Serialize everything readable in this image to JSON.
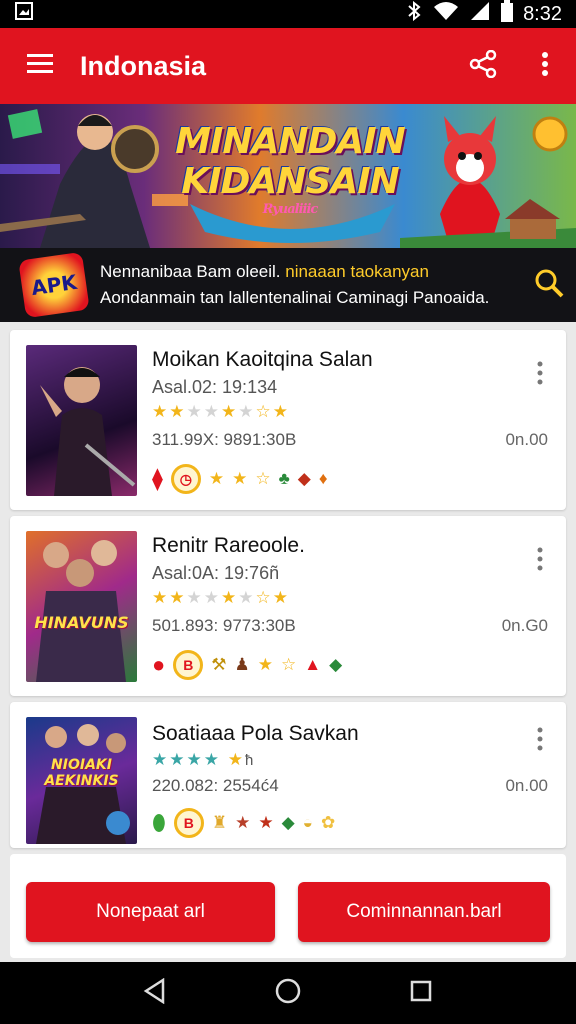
{
  "status_bar": {
    "time": "8:32",
    "icons": [
      "photo-icon",
      "bluetooth-icon",
      "wifi-icon",
      "signal-icon",
      "battery-icon"
    ]
  },
  "appbar": {
    "title": "Indonasia",
    "icons": [
      "menu-icon",
      "share-icon",
      "more-vert-icon"
    ]
  },
  "banner": {
    "title_line1": "MINANDAIN",
    "title_line2": "KIDANSAIN",
    "subtitle": "Ryualiiic"
  },
  "search_strip": {
    "logo_text": "APK",
    "line1_main": "Nennanibaa Bam oleeil.",
    "line1_accent": "ninaaan taokanyan",
    "line2": "Aondanmain tan lallentenalinai Caminagi Panoaida."
  },
  "apps": [
    {
      "title": "Moikan Kaoitqina Salan",
      "meta": "Asal.02: 19:134",
      "rating": 2.5,
      "size": "311.99X: 9891:30B",
      "price": "0n.00",
      "thumb_text": ""
    },
    {
      "title": "Renitr Rareoole.",
      "meta": "Asal:0A: 19:76ñ",
      "rating": 2,
      "size": "501.893: 9773:30B",
      "price": "0n.G0",
      "thumb_text": "HINAVUNS"
    },
    {
      "title": "Soatiaaa Pola Savkan",
      "meta": "",
      "rating": 3.5,
      "size": "220.082: 2554ć4",
      "price": "0n.00",
      "thumb_text": "NIOIAKI AEKINKIS"
    }
  ],
  "actions": {
    "left_label": "Nonepaat arl",
    "right_label": "Cominnannan.barl"
  },
  "colors": {
    "primary": "#e0141f",
    "accent_yellow": "#ffcc2a",
    "dark_strip": "#121216"
  }
}
